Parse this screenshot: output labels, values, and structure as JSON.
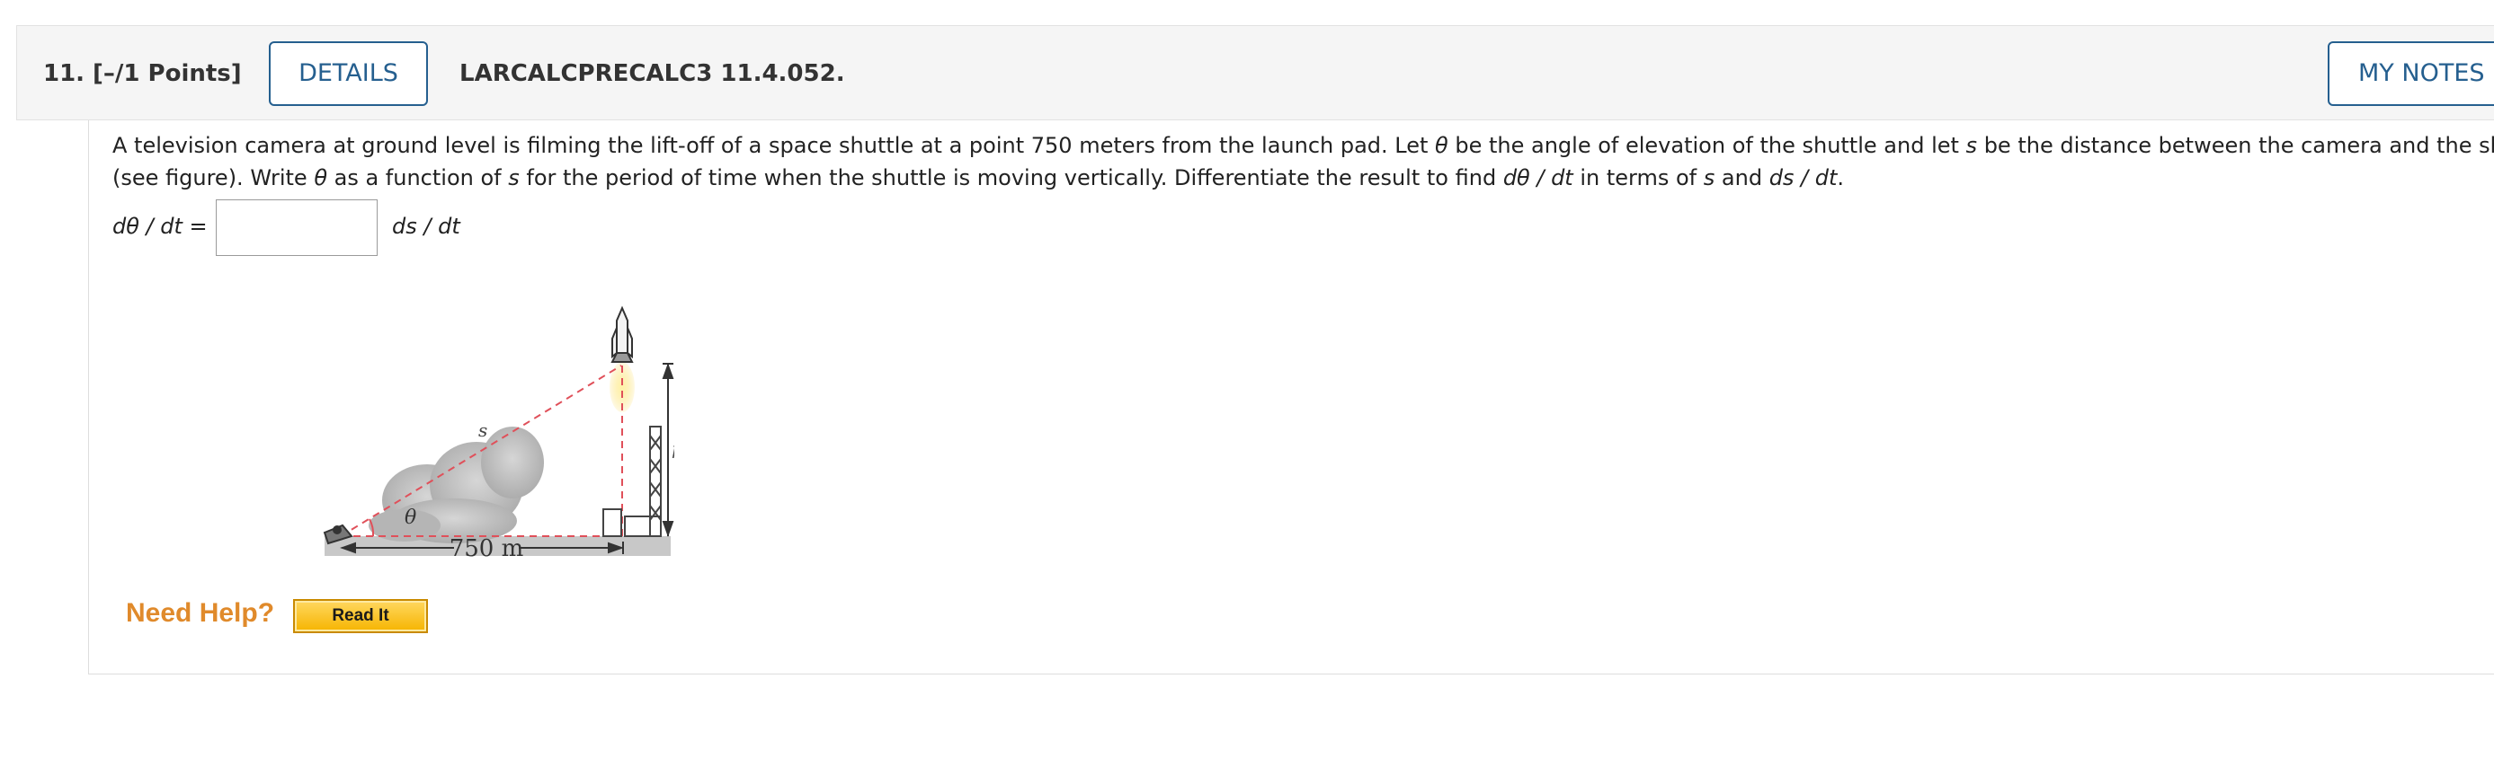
{
  "question": {
    "number": "11.",
    "points": "[–/1 Points]",
    "details_label": "DETAILS",
    "source": "LARCALCPRECALC3 11.4.052.",
    "my_notes_label": "MY NOTES"
  },
  "prompt": {
    "line1": [
      {
        "text": "A television camera at ground level is filming the lift-off of a space shuttle at a point 750 meters from the launch pad. Let ",
        "italic": false
      },
      {
        "text": "θ",
        "italic": true
      },
      {
        "text": " be the angle of elevation of the shuttle and let ",
        "italic": false
      },
      {
        "text": "s",
        "italic": true
      },
      {
        "text": " be the distance between the camera and the shuttle",
        "italic": false
      }
    ],
    "line2": [
      {
        "text": "(see figure). Write ",
        "italic": false
      },
      {
        "text": "θ",
        "italic": true
      },
      {
        "text": " as a function of ",
        "italic": false
      },
      {
        "text": "s",
        "italic": true
      },
      {
        "text": " for the period of time when the shuttle is moving vertically. Differentiate the result to find ",
        "italic": false
      },
      {
        "text": "dθ / dt",
        "italic": true
      },
      {
        "text": " in terms of ",
        "italic": false
      },
      {
        "text": "s",
        "italic": true
      },
      {
        "text": " and ",
        "italic": false
      },
      {
        "text": "ds / dt",
        "italic": true
      },
      {
        "text": ".",
        "italic": false
      }
    ]
  },
  "answer": {
    "label": "dθ / dt =",
    "value": "",
    "unit": "ds / dt"
  },
  "figure": {
    "s_label": "s",
    "h_label": "h",
    "theta_label": "θ",
    "distance_label": "750 m"
  },
  "help": {
    "need_help_label": "Need Help?",
    "read_it_label": "Read It"
  },
  "colors": {
    "accent_blue": "#255f8f",
    "help_orange": "#e08a2b",
    "read_it_gold": "#f6b400",
    "dashed_red": "#e0505a"
  }
}
